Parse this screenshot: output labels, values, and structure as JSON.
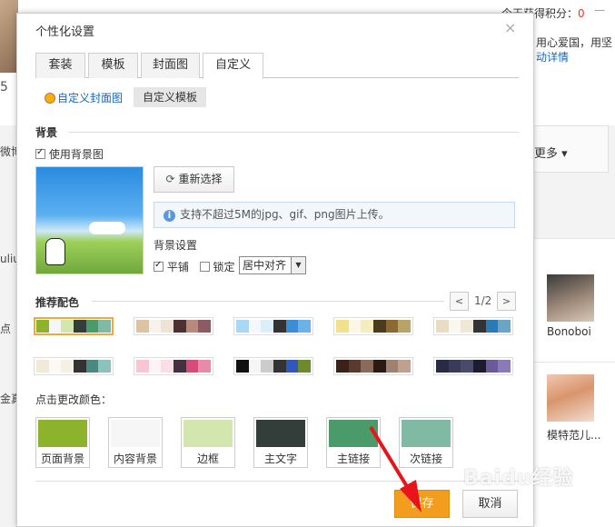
{
  "background_page": {
    "score_label": "今天获得积分：",
    "score_value": "0",
    "close_symbol": "—",
    "right_text1": "用心爱国，用坚",
    "right_text2": "动详情",
    "left_number": "5",
    "left_texts": [
      "微博",
      "uliu",
      "点",
      "金真"
    ],
    "more_label": "更多",
    "user1_name": "Bonoboi",
    "user2_name": "模特范儿..."
  },
  "dialog": {
    "title": "个性化设置",
    "close_symbol": "×",
    "tabs": [
      "套装",
      "模板",
      "封面图",
      "自定义"
    ],
    "active_tab": "自定义",
    "subtabs": [
      "自定义封面图",
      "自定义模板"
    ],
    "background": {
      "section_title": "背景",
      "use_bg_label": "使用背景图",
      "use_bg_checked": true,
      "reselect_label": "重新选择",
      "reselect_icon": "refresh-icon",
      "tip_icon": "info-icon",
      "tip_text": "支持不超过5M的jpg、gif、png图片上传。",
      "settings_label": "背景设置",
      "tile_label": "平铺",
      "tile_checked": true,
      "lock_label": "锁定",
      "lock_checked": false,
      "align_value": "居中对齐"
    },
    "colors": {
      "section_title": "推荐配色",
      "page_indicator": "1/2",
      "prev_symbol": "<",
      "next_symbol": ">",
      "palettes": [
        [
          "#8cb32b",
          "#f6f6f6",
          "#d2e6ad",
          "#333e3a",
          "#4a9a6a",
          "#80b9a4"
        ],
        [
          "#dcc4a2",
          "#f7f2ea",
          "#efe3d3",
          "#4d3030",
          "#b88a7b",
          "#8b5c64"
        ],
        [
          "#a8d8f4",
          "#f2f8fc",
          "#dceefa",
          "#333333",
          "#3a8ed6",
          "#6bb2e8"
        ],
        [
          "#f3e08a",
          "#fbf7e4",
          "#f5ecc0",
          "#4b3b1b",
          "#8c6a2f",
          "#b7a466"
        ],
        [
          "#e8dcc2",
          "#faf7ef",
          "#f0e8d6",
          "#333333",
          "#2a7ab8",
          "#6aa5c6"
        ],
        [
          "#f2ead8",
          "#fbf9f3",
          "#f5f0e3",
          "#333333",
          "#4a8a7e",
          "#8bc2be"
        ],
        [
          "#f7c6d2",
          "#fdf3f6",
          "#f8dee5",
          "#443040",
          "#d84a7a",
          "#e98aa8"
        ],
        [
          "#111111",
          "#f5f5f5",
          "#cccccc",
          "#333333",
          "#2f58b8",
          "#6f8a2a"
        ],
        [
          "#3a2218",
          "#5a3a2c",
          "#8a6a5a",
          "#2a1a14",
          "#a0806e",
          "#c0a090"
        ],
        [
          "#2a2a44",
          "#3a3a5a",
          "#4a4a6a",
          "#1c1c2e",
          "#6a5a9a",
          "#8a7aba"
        ]
      ],
      "change_label": "点击更改颜色：",
      "tiles": [
        {
          "label": "页面背景",
          "color": "#8cb32b"
        },
        {
          "label": "内容背景",
          "color": "#f6f6f6"
        },
        {
          "label": "边框",
          "color": "#d2e6ad"
        },
        {
          "label": "主文字",
          "color": "#333e3a"
        },
        {
          "label": "主链接",
          "color": "#4a9a6a"
        },
        {
          "label": "次链接",
          "color": "#80b9a4"
        }
      ]
    },
    "footer": {
      "save_label": "保存",
      "cancel_label": "取消"
    }
  },
  "watermark": "Baidu经验",
  "accent_color": "#f29d1d"
}
